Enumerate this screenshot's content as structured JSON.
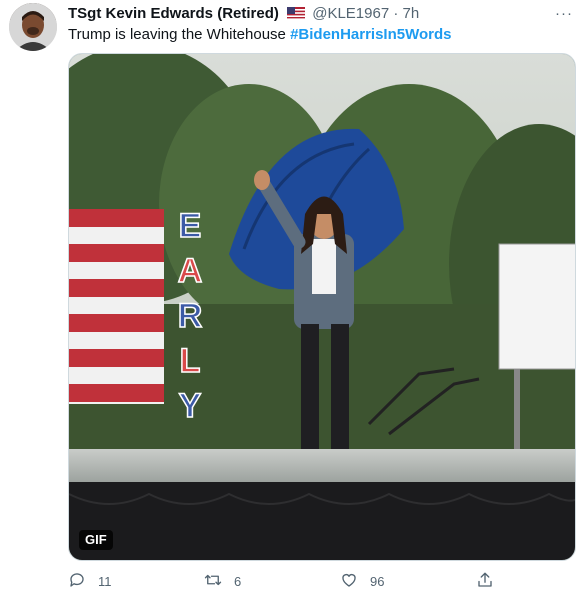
{
  "tweet": {
    "author_name": "TSgt Kevin Edwards (Retired)",
    "handle": "@KLE1967",
    "separator": "·",
    "time": "7h",
    "more": "···",
    "text": "Trump is leaving the Whitehouse ",
    "hashtag": "#BidenHarrisIn5Words",
    "media": {
      "badge": "GIF",
      "sign_text": "EARLY"
    },
    "actions": {
      "replies": "11",
      "retweets": "6",
      "likes": "96"
    },
    "colors": {
      "accent": "#1d9bf0",
      "muted": "#536471"
    }
  }
}
